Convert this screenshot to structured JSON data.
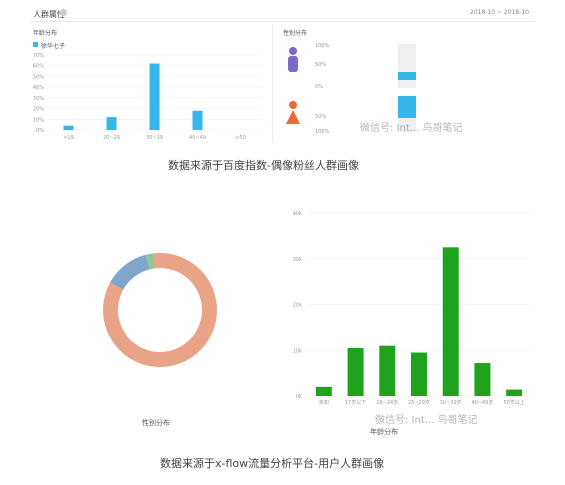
{
  "top_panel": {
    "title": "人群属性",
    "date_range": "2018-10 ~ 2018-10",
    "left_subtitle": "年龄分布",
    "legend_label": "徐华七子",
    "right_subtitle": "性别分布",
    "gender_ticks": [
      "100%",
      "50%",
      "0%",
      "50%",
      "100%"
    ]
  },
  "watermark_top": "微信号: Int... 鸟哥笔记",
  "caption_top": "数据来源于百度指数-偶像粉丝人群画像",
  "donut": {
    "label": "性别分布"
  },
  "watermark_bottom": "微信号: Int... 鸟哥笔记",
  "caption_bottom": "数据来源于x-flow流量分析平台-用户人群画像",
  "colors": {
    "blue": "#35b7ea",
    "green": "#1fa31f",
    "salmon": "#e9a488",
    "steel": "#7fa7cb",
    "lightgreen": "#8fc78f"
  },
  "chart_data": [
    {
      "type": "bar",
      "title": "年龄分布",
      "categories": [
        "<19",
        "20~29",
        "30~39",
        "40~49",
        ">50"
      ],
      "series": [
        {
          "name": "徐华七子",
          "values": [
            4,
            12,
            62,
            18,
            0
          ]
        }
      ],
      "yticks": [
        "0%",
        "10%",
        "20%",
        "30%",
        "40%",
        "50%",
        "60%",
        "70%"
      ],
      "ylim": [
        0,
        70
      ]
    },
    {
      "type": "bar",
      "title": "性别分布",
      "categories": [
        "男",
        "女"
      ],
      "values": [
        10,
        20
      ]
    },
    {
      "type": "pie",
      "title": "性别分布",
      "values": [
        85,
        13,
        2
      ],
      "colors": [
        "#e9a488",
        "#7fa7cb",
        "#8fc78f"
      ]
    },
    {
      "type": "bar",
      "title": "年龄分布",
      "categories": [
        "未知",
        "17岁以下",
        "18~24岁",
        "25~29岁",
        "30~39岁",
        "40~49岁",
        "50岁以上"
      ],
      "values": [
        2000,
        10500,
        11000,
        9500,
        32500,
        7200,
        1400
      ],
      "yticks": [
        "0k",
        "10k",
        "20k",
        "30k",
        "40k"
      ],
      "ylim": [
        0,
        40000
      ]
    }
  ]
}
